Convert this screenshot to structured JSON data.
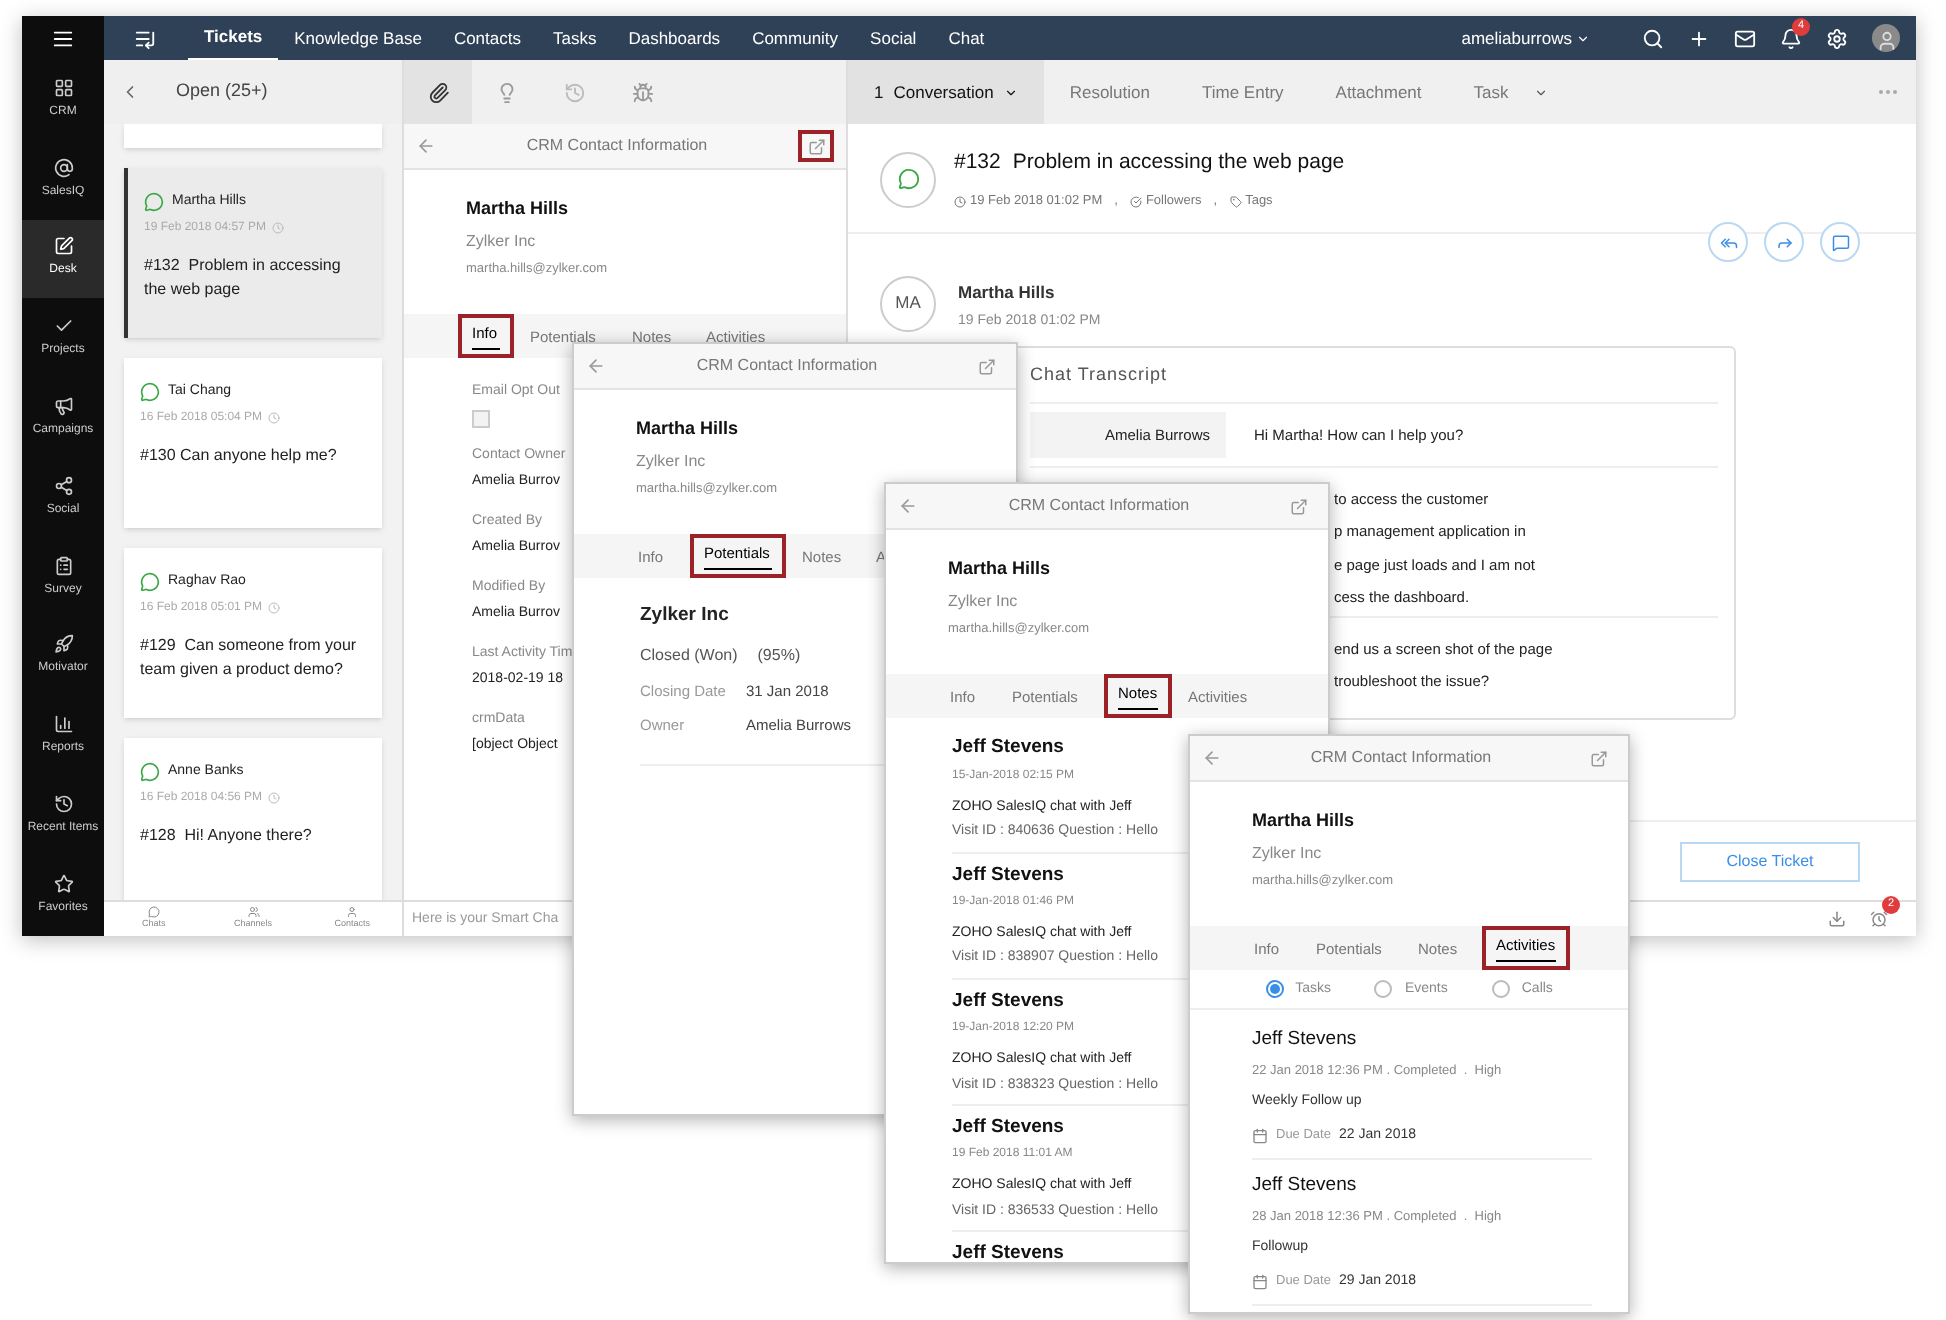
{
  "sidebar": {
    "items": [
      {
        "label": "CRM",
        "selected": false
      },
      {
        "label": "SalesIQ",
        "selected": false
      },
      {
        "label": "Desk",
        "selected": true
      },
      {
        "label": "Projects",
        "selected": false
      },
      {
        "label": "Campaigns",
        "selected": false
      },
      {
        "label": "Social",
        "selected": false
      },
      {
        "label": "Survey",
        "selected": false
      },
      {
        "label": "Motivator",
        "selected": false
      },
      {
        "label": "Reports",
        "selected": false
      },
      {
        "label": "Recent Items",
        "selected": false
      },
      {
        "label": "Favorites",
        "selected": false
      }
    ]
  },
  "topnav": {
    "tabs": [
      {
        "label": "Tickets",
        "selected": true
      },
      {
        "label": "Knowledge Base",
        "selected": false
      },
      {
        "label": "Contacts",
        "selected": false
      },
      {
        "label": "Tasks",
        "selected": false
      },
      {
        "label": "Dashboards",
        "selected": false
      },
      {
        "label": "Community",
        "selected": false
      },
      {
        "label": "Social",
        "selected": false
      },
      {
        "label": "Chat",
        "selected": false
      }
    ],
    "user": "ameliaburrows",
    "notification_count": "4"
  },
  "ticket_list": {
    "header": "Open (25+)",
    "tickets": [
      {
        "name": "Martha Hills",
        "time": "19 Feb 2018 04:57 PM",
        "title": "#132  Problem in accessing the web page",
        "selected": true
      },
      {
        "name": "Tai Chang",
        "time": "16 Feb 2018 05:04 PM",
        "title": "#130 Can anyone help me?",
        "selected": false
      },
      {
        "name": "Raghav Rao",
        "time": "16 Feb 2018 05:01 PM",
        "title": "#129  Can someone from your team given a product demo?",
        "selected": false
      },
      {
        "name": "Anne Banks",
        "time": "16 Feb 2018 04:56 PM",
        "title": "#128  Hi! Anyone there?",
        "selected": false
      }
    ],
    "bottom_tabs": [
      "Chats",
      "Channels",
      "Contacts"
    ]
  },
  "smart_chat": {
    "placeholder": "Here is your Smart Cha"
  },
  "crm_panels": [
    {
      "kind": "info",
      "title": "CRM Contact Information",
      "open_highlighted": true,
      "name": "Martha Hills",
      "company": "Zylker Inc",
      "email": "martha.hills@zylker.com",
      "tabs": [
        {
          "label": "Info",
          "selected": true
        },
        {
          "label": "Potentials",
          "selected": false
        },
        {
          "label": "Notes",
          "selected": false
        },
        {
          "label": "Activities",
          "selected": false
        }
      ],
      "fields": [
        {
          "label": "Email Opt Out",
          "kind": "checkbox",
          "checked": false
        },
        {
          "label": "Contact Owner",
          "value": "Amelia Burrov"
        },
        {
          "label": "Created By",
          "value": "Amelia Burrov"
        },
        {
          "label": "Modified By",
          "value": "Amelia Burrov"
        },
        {
          "label": "Last Activity Tim",
          "value": "2018-02-19 18"
        },
        {
          "label": "crmData",
          "value": "[object Object"
        }
      ]
    },
    {
      "kind": "potentials",
      "title": "CRM Contact Information",
      "open_highlighted": false,
      "name": "Martha Hills",
      "company": "Zylker Inc",
      "email": "martha.hills@zylker.com",
      "tabs": [
        {
          "label": "Info",
          "selected": false
        },
        {
          "label": "Potentials",
          "selected": true
        },
        {
          "label": "Notes",
          "selected": false
        },
        {
          "label": "A",
          "selected": false
        }
      ],
      "potential": {
        "name": "Zylker Inc",
        "stage": "Closed (Won)",
        "probability": "(95%)",
        "rows": [
          {
            "label": "Closing Date",
            "value": "31 Jan 2018"
          },
          {
            "label": "Owner",
            "value": "Amelia Burrows"
          }
        ]
      }
    },
    {
      "kind": "notes",
      "title": "CRM Contact Information",
      "open_highlighted": false,
      "name": "Martha Hills",
      "company": "Zylker Inc",
      "email": "martha.hills@zylker.com",
      "tabs": [
        {
          "label": "Info",
          "selected": false
        },
        {
          "label": "Potentials",
          "selected": false
        },
        {
          "label": "Notes",
          "selected": true
        },
        {
          "label": "Activities",
          "selected": false
        }
      ],
      "notes": [
        {
          "author": "Jeff Stevens",
          "time": "15-Jan-2018 02:15 PM",
          "text": "ZOHO SalesIQ chat with Jeff",
          "detail": "Visit ID : 840636 Question : Hello"
        },
        {
          "author": "Jeff Stevens",
          "time": "19-Jan-2018 01:46 PM",
          "text": "ZOHO SalesIQ chat with Jeff",
          "detail": "Visit ID : 838907 Question : Hello"
        },
        {
          "author": "Jeff Stevens",
          "time": "19-Jan-2018 12:20 PM",
          "text": "ZOHO SalesIQ chat with Jeff",
          "detail": "Visit ID : 838323 Question : Hello"
        },
        {
          "author": "Jeff Stevens",
          "time": "19 Feb 2018 11:01 AM",
          "text": "ZOHO SalesIQ chat with Jeff",
          "detail": "Visit ID : 836533 Question : Hello"
        },
        {
          "author": "Jeff Stevens"
        }
      ]
    },
    {
      "kind": "activities",
      "title": "CRM Contact Information",
      "open_highlighted": false,
      "name": "Martha Hills",
      "company": "Zylker Inc",
      "email": "martha.hills@zylker.com",
      "tabs": [
        {
          "label": "Info",
          "selected": false
        },
        {
          "label": "Potentials",
          "selected": false
        },
        {
          "label": "Notes",
          "selected": false
        },
        {
          "label": "Activities",
          "selected": true
        }
      ],
      "filters": [
        {
          "label": "Tasks",
          "selected": true
        },
        {
          "label": "Events",
          "selected": false
        },
        {
          "label": "Calls",
          "selected": false
        }
      ],
      "activities": [
        {
          "author": "Jeff Stevens",
          "meta": "22 Jan 2018 12:36 PM . Completed  .  High",
          "title": "Weekly Follow up",
          "due_label": "Due Date",
          "due": "22 Jan 2018"
        },
        {
          "author": "Jeff Stevens",
          "meta": "28 Jan 2018 12:36 PM . Completed  .  High",
          "title": "Followup",
          "due_label": "Due Date",
          "due": "29 Jan 2018"
        }
      ]
    }
  ],
  "conversation": {
    "tabs": [
      {
        "count": "1",
        "label": "Conversation",
        "selected": true
      },
      {
        "label": "Resolution",
        "selected": false
      },
      {
        "label": "Time Entry",
        "selected": false
      },
      {
        "label": "Attachment",
        "selected": false
      },
      {
        "label": "Task",
        "selected": false
      }
    ],
    "ticket": {
      "number": "#132",
      "subject": "Problem in accessing the web page",
      "meta": [
        {
          "kind": "date",
          "text": "19 Feb 2018 01:02 PM"
        },
        {
          "kind": "sep",
          "text": ","
        },
        {
          "kind": "followers",
          "text": "Followers"
        },
        {
          "kind": "sep",
          "text": ","
        },
        {
          "kind": "tags",
          "text": "Tags"
        }
      ]
    },
    "message": {
      "initials": "MA",
      "author": "Martha Hills",
      "time": "19 Feb 2018 01:02 PM",
      "transcript_title": "Chat Transcript",
      "rows": [
        {
          "speaker": "Amelia Burrows",
          "lines": [
            "Hi Martha! How can I help you?"
          ]
        },
        {
          "lines": [
            "to access the customer",
            "p management application in",
            "e page just loads and I am not",
            "cess the dashboard."
          ]
        },
        {
          "lines": [
            "end us a screen shot of the page",
            "troubleshoot the issue?"
          ]
        }
      ]
    },
    "close_button": "Close Ticket",
    "reminder_count": "2"
  }
}
